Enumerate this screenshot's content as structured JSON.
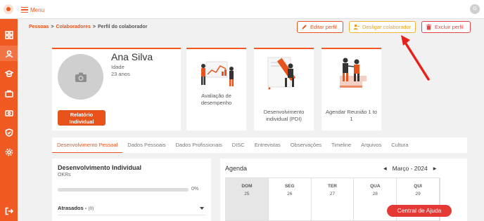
{
  "topbar": {
    "menu_label": "Menu",
    "avatar_initial": "G"
  },
  "sidebar": {
    "icons": [
      "dashboard-icon",
      "people-icon",
      "graduation-icon",
      "briefcase-icon",
      "money-icon",
      "shield-icon",
      "settings-icon",
      "logout-icon"
    ]
  },
  "breadcrumb": {
    "items": [
      "Pessoas",
      "Colaboradores",
      "Perfil do colaborador"
    ],
    "separator": ">"
  },
  "actions": {
    "edit": "Editar perfil",
    "deactivate": "Desligar colaborador",
    "delete": "Excluir perfil"
  },
  "profile": {
    "name": "Ana Silva",
    "age_label": "Idade",
    "age": "23 anos",
    "report_button": "Relatório Individual"
  },
  "cards": [
    {
      "label": "Avaliação de desempenho"
    },
    {
      "label": "Desenvolvimento individual (PDI)"
    },
    {
      "label": "Agendar Reunião 1 to 1"
    }
  ],
  "tabs": [
    "Desenvolvimento Pessoal",
    "Dados Pessoais",
    "Dados Profissionais",
    "DISC",
    "Entrevistas",
    "Observações",
    "Timeline",
    "Arquivos",
    "Cultura"
  ],
  "development": {
    "title": "Desenvolvimento Individual",
    "subtitle": "OKRs",
    "progress": 0,
    "progress_text": "0%",
    "late_label": "Atrasados -",
    "late_count": "(0)"
  },
  "agenda": {
    "title": "Agenda",
    "month": "Março - 2024",
    "prev": "◀",
    "next": "▶",
    "days": [
      {
        "name": "DOM",
        "num": "25"
      },
      {
        "name": "SEG",
        "num": "26"
      },
      {
        "name": "TER",
        "num": "27"
      },
      {
        "name": "QUA",
        "num": "28"
      },
      {
        "name": "QUI",
        "num": "29"
      }
    ]
  },
  "help": {
    "label": "Central de Ajuda"
  },
  "colors": {
    "brand": "#f05a22",
    "warning": "#f2b233",
    "danger": "#e64545",
    "arrow": "#e8211a"
  }
}
